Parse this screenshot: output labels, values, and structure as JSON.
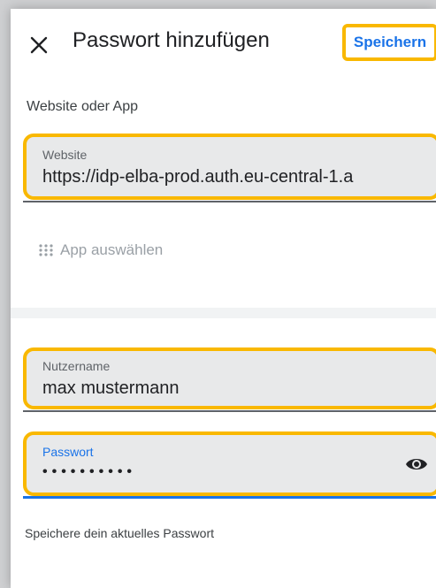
{
  "header": {
    "close_icon": "close-icon",
    "title": "Passwort hinzufügen",
    "save_label": "Speichern"
  },
  "form": {
    "section_label": "Website oder App",
    "website": {
      "label": "Website",
      "value": "https://idp-elba-prod.auth.eu-central-1.a"
    },
    "app_select": {
      "icon": "apps-grid-icon",
      "label": "App auswählen"
    },
    "username": {
      "label": "Nutzername",
      "value": "max mustermann"
    },
    "password": {
      "label": "Passwort",
      "value": "••••••••••",
      "toggle_icon": "eye-icon"
    },
    "hint": "Speichere dein aktuelles Passwort"
  },
  "colors": {
    "accent": "#1a73e8",
    "highlight": "#f9b800",
    "field_background": "#e8e9ea"
  }
}
